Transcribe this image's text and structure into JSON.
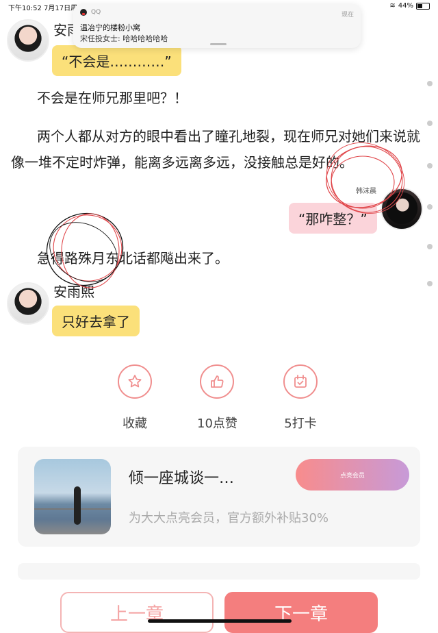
{
  "status_bar": {
    "time": "下午10:52  7月17日周",
    "battery": "44%"
  },
  "notification": {
    "app": "QQ",
    "when": "现在",
    "title": "温冶宁的楼粉小窝",
    "message": "宋任投女士: 哈哈哈哈哈哈"
  },
  "chat": {
    "m1_name": "安雨",
    "m1_text": "“不会是…………”",
    "p1": "不会是在师兄那里吧？！",
    "p2": "两个人都从对方的眼中看出了瞳孔地裂，现在师兄对她们来说就像一堆不定时炸弹，能离多远离多远，没接触总是好的。",
    "m2_name": "韩沫晨",
    "m2_text": "“那咋整？”",
    "p3": "急得路殊月东北话都飚出来了。",
    "m3_name": "安雨熙",
    "m3_text": "只好去拿了"
  },
  "actions": [
    {
      "label": "收藏",
      "icon": "star-icon"
    },
    {
      "label": "10点赞",
      "icon": "thumbs-up-icon"
    },
    {
      "label": "5打卡",
      "icon": "calendar-check-icon"
    }
  ],
  "promo": {
    "title": "倾一座城谈一…",
    "subtitle": "为大大点亮会员，官方额外补贴30%",
    "button": "点亮会员"
  },
  "nav": {
    "prev": "上一章",
    "next": "下一章"
  },
  "colors": {
    "accent": "#f47e7e",
    "bubble_yellow": "#fbe07a",
    "bubble_pink": "#fbd4da"
  }
}
